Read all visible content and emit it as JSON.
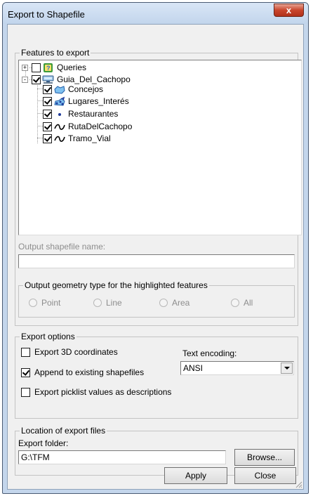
{
  "window": {
    "title": "Export to Shapefile",
    "close_icon": "close-icon",
    "close_glyph": "x",
    "accent": "#c9452c"
  },
  "features": {
    "legend": "Features to export",
    "tree": [
      {
        "label": "Queries",
        "checked": false,
        "expander": "+",
        "icon": "query-icon"
      },
      {
        "label": "Guia_Del_Cachopo",
        "checked": true,
        "expander": "-",
        "icon": "database-icon"
      },
      {
        "label": "Concejos",
        "checked": true,
        "icon": "polygon-layer-icon"
      },
      {
        "label": "Lugares_Interés",
        "checked": true,
        "icon": "points-layer-icon"
      },
      {
        "label": "Restaurantes",
        "checked": true,
        "icon": "point-layer-icon"
      },
      {
        "label": "RutaDelCachopo",
        "checked": true,
        "icon": "line-layer-icon"
      },
      {
        "label": "Tramo_Vial",
        "checked": true,
        "icon": "line-layer-icon"
      }
    ],
    "output_name_label": "Output shapefile name:",
    "output_name_value": "",
    "geometry": {
      "legend": "Output geometry type for the highlighted features",
      "options": [
        "Point",
        "Line",
        "Area",
        "All"
      ]
    }
  },
  "export_options": {
    "legend": "Export options",
    "export_3d_label": "Export 3D coordinates",
    "export_3d_checked": false,
    "append_label": "Append to existing shapefiles",
    "append_checked": true,
    "picklist_label": "Export picklist values as descriptions",
    "picklist_checked": false,
    "encoding_label": "Text encoding:",
    "encoding_value": "ANSI"
  },
  "location": {
    "legend": "Location of export files",
    "folder_label": "Export folder:",
    "folder_value": "G:\\TFM",
    "browse_label": "Browse..."
  },
  "buttons": {
    "apply": "Apply",
    "close": "Close"
  }
}
